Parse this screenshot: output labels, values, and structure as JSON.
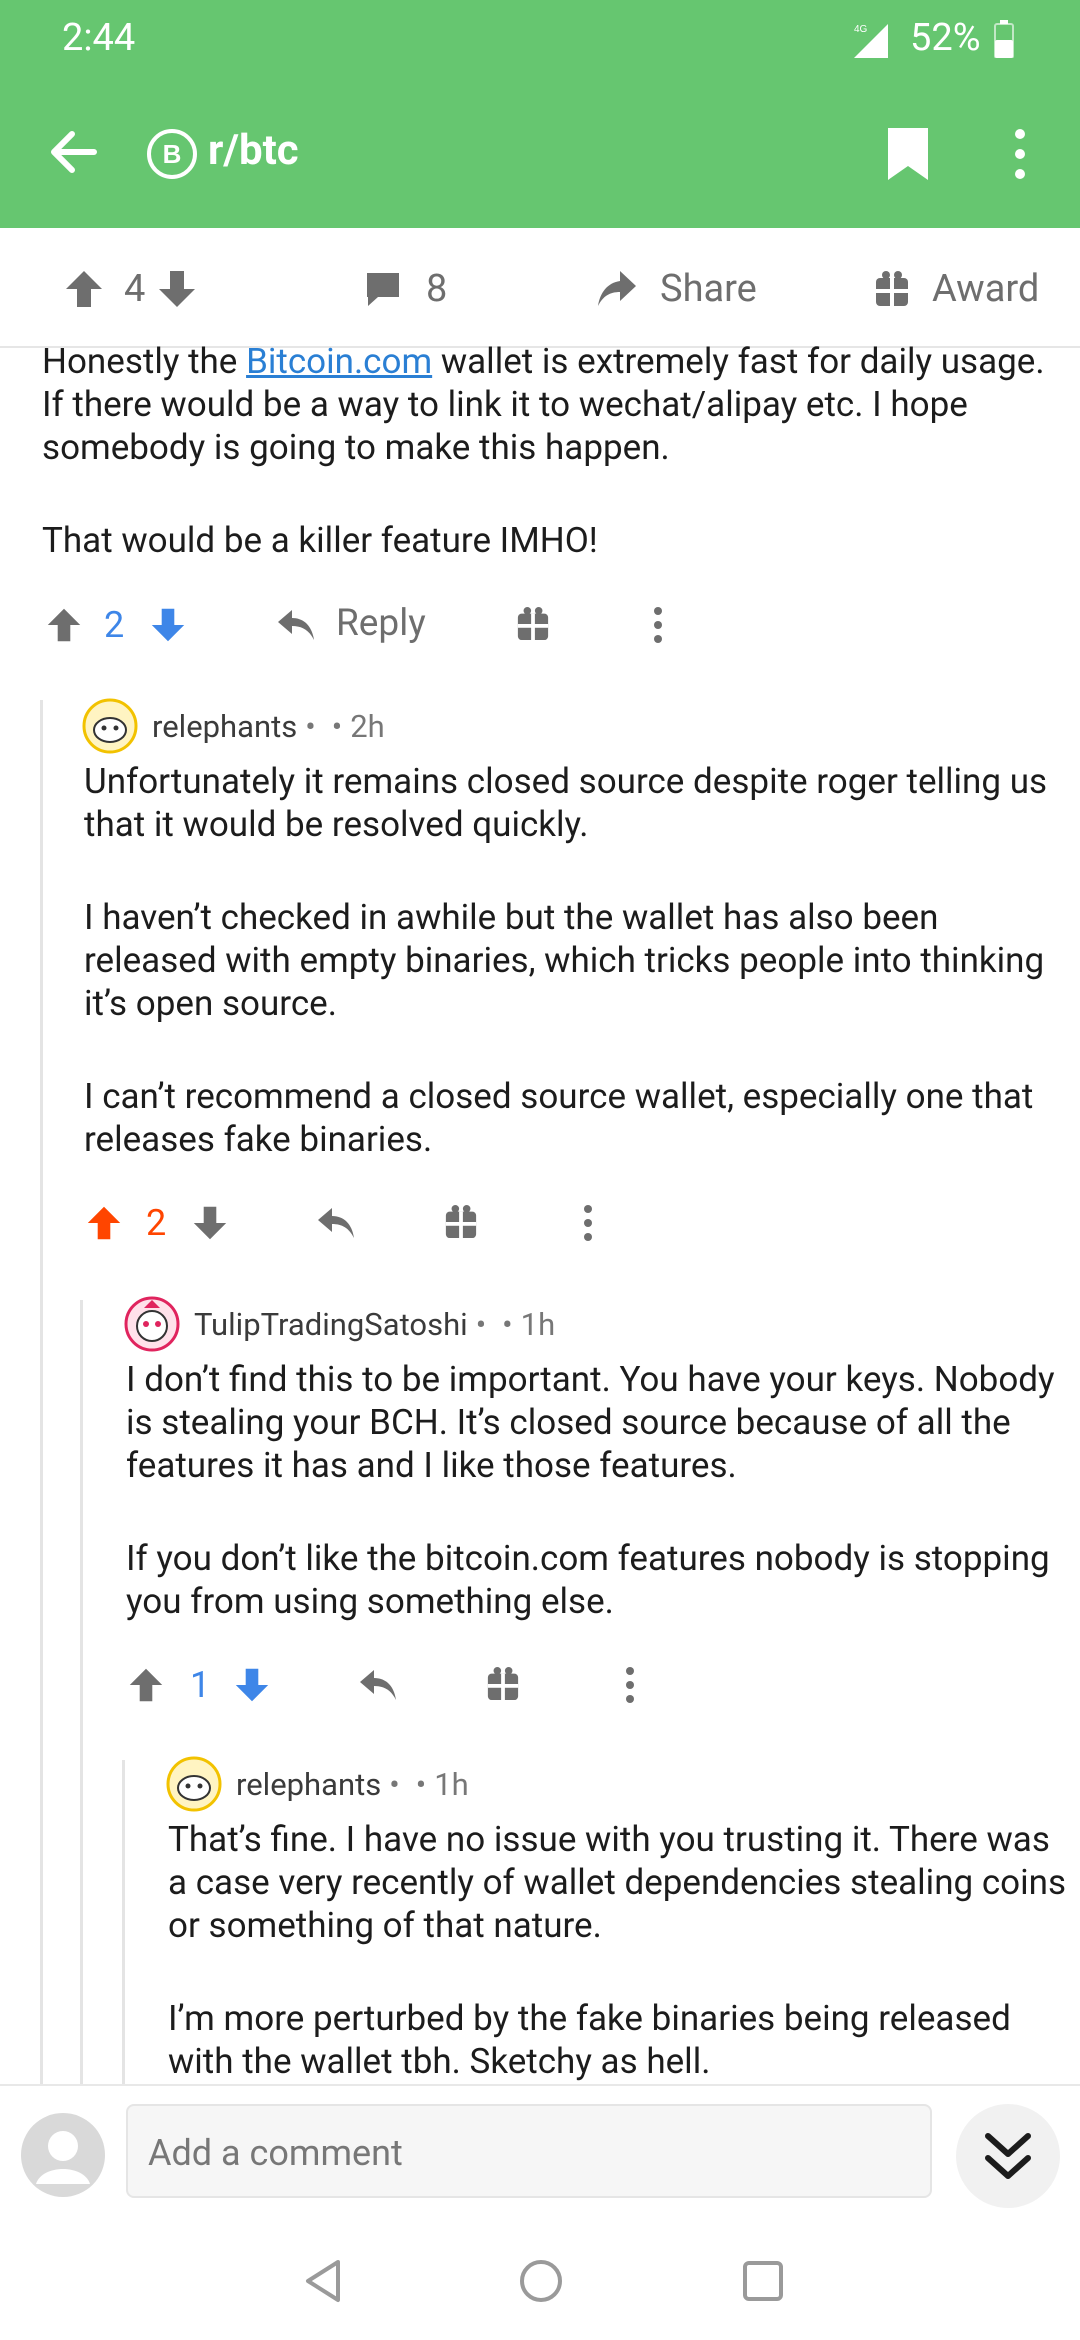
{
  "status": {
    "time": "2:44",
    "network": "4G",
    "battery": "52%"
  },
  "header": {
    "subreddit": "r/btc",
    "sub_icon_glyph": "B"
  },
  "action_bar": {
    "votes": "4",
    "comments": "8",
    "share_label": "Share",
    "award_label": "Award"
  },
  "comments": [
    {
      "paragraphs": [
        {
          "before": "Honestly the ",
          "link": "Bitcoin.com",
          "after": " wallet is extremely fast for daily usage. If there would be a way to link it to wechat/alipay etc. I hope somebody is going to make this happen."
        },
        {
          "text": "That would be a killer feature IMHO!"
        }
      ],
      "votes": "2",
      "reply_label": "Reply"
    },
    {
      "author": "relephants",
      "time": "2h",
      "paragraphs": [
        "Unfortunately it remains closed source despite roger telling us that it would be resolved quickly.",
        "I haven’t checked in awhile but the wallet has also been released with empty binaries, which tricks people into thinking it’s open source.",
        "I can’t recommend a closed source wallet, especially one that releases fake binaries."
      ],
      "votes": "2"
    },
    {
      "author": "TulipTradingSatoshi",
      "time": "1h",
      "paragraphs": [
        "I don’t find this to be important. You have your keys. Nobody is stealing your BCH. It’s closed source because of all the features it has and I like those features.",
        "If you don’t like the bitcoin.com features nobody is stopping you from using something else."
      ],
      "votes": "1"
    },
    {
      "author": "relephants",
      "time": "1h",
      "paragraphs": [
        "That’s fine. I have no issue with you trusting it. There was a case very recently of wallet dependencies stealing coins or something of that nature.",
        "I’m more perturbed by the fake binaries being released with the wallet tbh. Sketchy as hell."
      ]
    }
  ],
  "comment_bar": {
    "placeholder": "Add a comment"
  },
  "colors": {
    "header": "#66c670",
    "upvote_active": "#ff4500",
    "downvote": "#3e86e8",
    "link": "#2a7fd4"
  },
  "icons": [
    "back-arrow-icon",
    "bitcoin-icon",
    "bookmark-icon",
    "overflow-menu-icon",
    "upvote-icon",
    "downvote-icon",
    "comment-icon",
    "share-icon",
    "gift-icon",
    "reply-icon",
    "avatar-icon",
    "chevron-double-down-icon"
  ]
}
